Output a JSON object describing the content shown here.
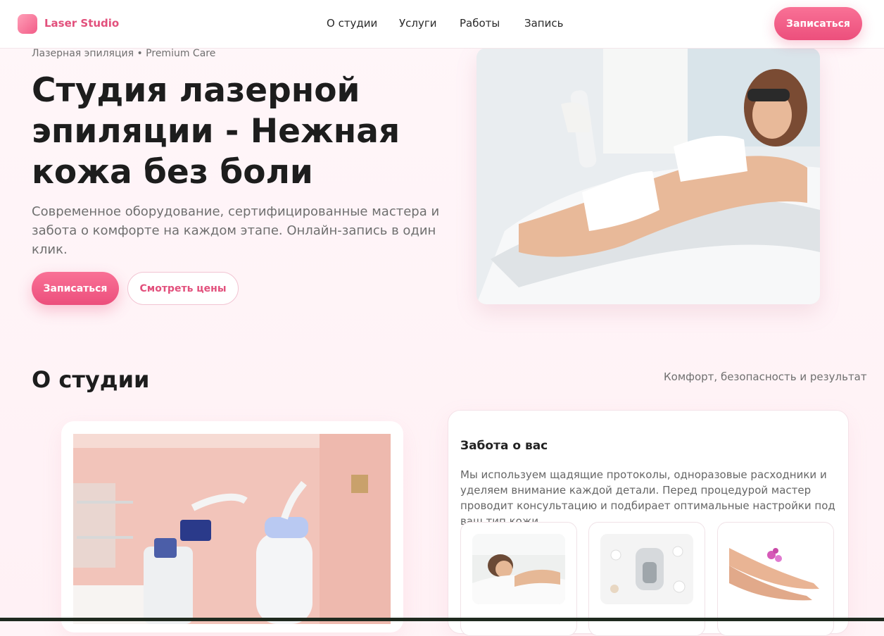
{
  "header": {
    "logo_text": "Laser Studio",
    "nav": [
      "О студии",
      "Услуги",
      "Работы",
      "Запись"
    ],
    "cta": "Записаться"
  },
  "hero": {
    "eyebrow": "Лазерная эпиляция • Premium Care",
    "title": "Студия лазерной эпиляции - Нежная кожа без боли",
    "subtitle": "Современное оборудование, сертифицированные мастера и забота о комфорте на каждом этапе. Онлайн-запись в один клик.",
    "primary_button": "Записаться",
    "secondary_button": "Смотреть цены"
  },
  "about": {
    "title": "О студии",
    "tagline": "Комфорт, безопасность и результат",
    "care_title": "Забота о вас",
    "care_text": "Мы используем щадящие протоколы, одноразовые расходники и уделяем внимание каждой детали. Перед процедурой мастер проводит консультацию и подбирает оптимальные настройки под ваш тип кожи."
  },
  "colors": {
    "accent": "#ec4f7c",
    "accent_light": "#f97196",
    "background": "#fff4f7",
    "text": "#1d1d1d",
    "muted": "#6f6f6f"
  }
}
